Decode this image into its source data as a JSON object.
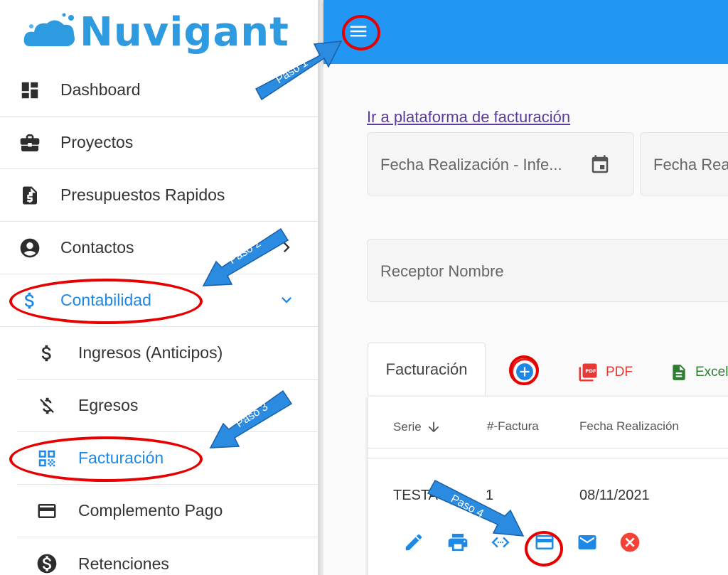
{
  "brand": {
    "name": "Nuvigant"
  },
  "sidebar": {
    "items": [
      {
        "label": "Dashboard",
        "icon": "dashboard-icon"
      },
      {
        "label": "Proyectos",
        "icon": "briefcase-icon"
      },
      {
        "label": "Presupuestos Rapidos",
        "icon": "invoice-icon"
      },
      {
        "label": "Contactos",
        "icon": "account-circle-icon"
      },
      {
        "label": "Contabilidad",
        "icon": "dollar-icon"
      },
      {
        "label": "Ingresos (Anticipos)",
        "icon": "dollar-icon"
      },
      {
        "label": "Egresos",
        "icon": "money-off-icon"
      },
      {
        "label": "Facturación",
        "icon": "qr-code-icon"
      },
      {
        "label": "Complemento Pago",
        "icon": "credit-card-icon"
      },
      {
        "label": "Retenciones",
        "icon": "dollar-circle-icon"
      }
    ]
  },
  "main": {
    "billing_link": "Ir a plataforma de facturación",
    "filters": {
      "date_from_placeholder": "Fecha Realización - Infe...",
      "date_to_placeholder": "Fecha Rea",
      "receiver_placeholder": "Receptor Nombre"
    },
    "tab_label": "Facturación",
    "pdf_label": "PDF",
    "excel_label": "Excel",
    "table": {
      "columns": [
        "Serie",
        "#-Factura",
        "Fecha Realización"
      ],
      "rows": [
        {
          "serie": "TESTA",
          "numero": "1",
          "fecha": "08/11/2021"
        }
      ]
    }
  },
  "annotations": [
    "Paso 1",
    "Paso 2",
    "Paso 3",
    "Paso 4"
  ],
  "colors": {
    "primary": "#2196f3",
    "active": "#1e88e5",
    "annotation_ring": "#e60000",
    "annotation_arrow": "#2b8be0"
  }
}
